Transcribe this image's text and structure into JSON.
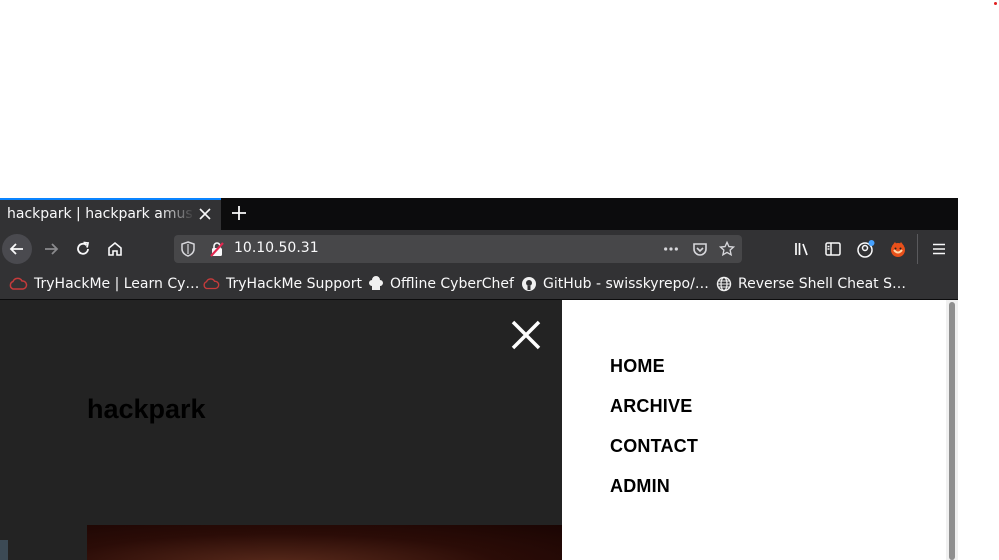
{
  "tab": {
    "title": "hackpark | hackpark amusement park"
  },
  "url": "10.10.50.31",
  "bookmarks": [
    {
      "label": "TryHackMe | Learn Cy…",
      "icon": "tryhackme-icon"
    },
    {
      "label": "TryHackMe Support",
      "icon": "tryhackme-icon"
    },
    {
      "label": "Offline CyberChef",
      "icon": "chef-hat-icon"
    },
    {
      "label": "GitHub - swisskyrepo/…",
      "icon": "github-icon"
    },
    {
      "label": "Reverse Shell Cheat S…",
      "icon": "globe-icon"
    }
  ],
  "site": {
    "title": "hackpark"
  },
  "menu": {
    "items": [
      "HOME",
      "ARCHIVE",
      "CONTACT",
      "ADMIN"
    ]
  },
  "colors": {
    "accent": "#0a84ff",
    "toolbar": "#323234",
    "page_bg": "#232323"
  }
}
